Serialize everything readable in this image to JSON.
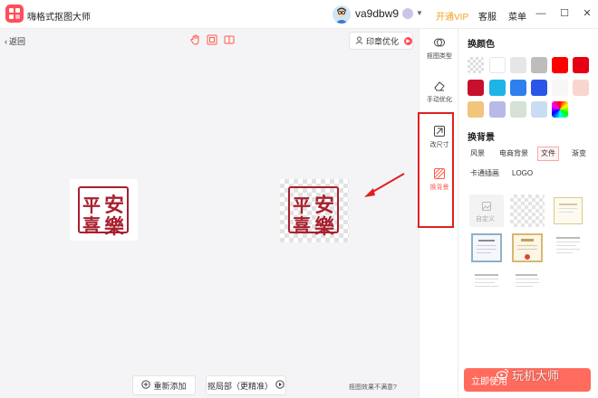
{
  "app": {
    "title": "嗨格式抠图大师",
    "user_name": "va9dbw9",
    "vip_label": "开通VIP",
    "service_label": "客服",
    "menu_label": "菜单"
  },
  "canvas": {
    "back_label": "返回",
    "optimize_label": "印章优化",
    "seal_chars": [
      "安",
      "平",
      "樂",
      "喜"
    ],
    "add_label": "重新添加",
    "precise_label": "抠局部（更精准）",
    "unsatisfied_label": "抠图效果不满意?"
  },
  "strip": {
    "items": [
      {
        "label": "抠图类型",
        "icon": "layers-icon"
      },
      {
        "label": "手动优化",
        "icon": "eraser-icon"
      },
      {
        "label": "改尺寸",
        "icon": "resize-icon"
      },
      {
        "label": "换背景",
        "icon": "background-icon"
      }
    ]
  },
  "panel": {
    "color_heading": "换颜色",
    "colors": [
      "transparent",
      "#ffffff",
      "#e6e6e6",
      "#bdbdbd",
      "#ff0000",
      "#e60012",
      "#c8102e",
      "#1eb4e6",
      "#2f80ed",
      "#2a56e8",
      "#f7f7f7",
      "#f9d5cf",
      "#f2c57c",
      "#b9b9e8",
      "#d5e2d5",
      "#c9dcf2",
      "gradient"
    ],
    "bg_heading": "换背景",
    "tabs": [
      "风景",
      "电商背景",
      "文件",
      "渐变",
      "卡通插画",
      "LOGO"
    ],
    "active_tab": "文件",
    "custom_label": "自定义",
    "use_button_label": "立即使用",
    "watermark_text": "玩机大师"
  }
}
